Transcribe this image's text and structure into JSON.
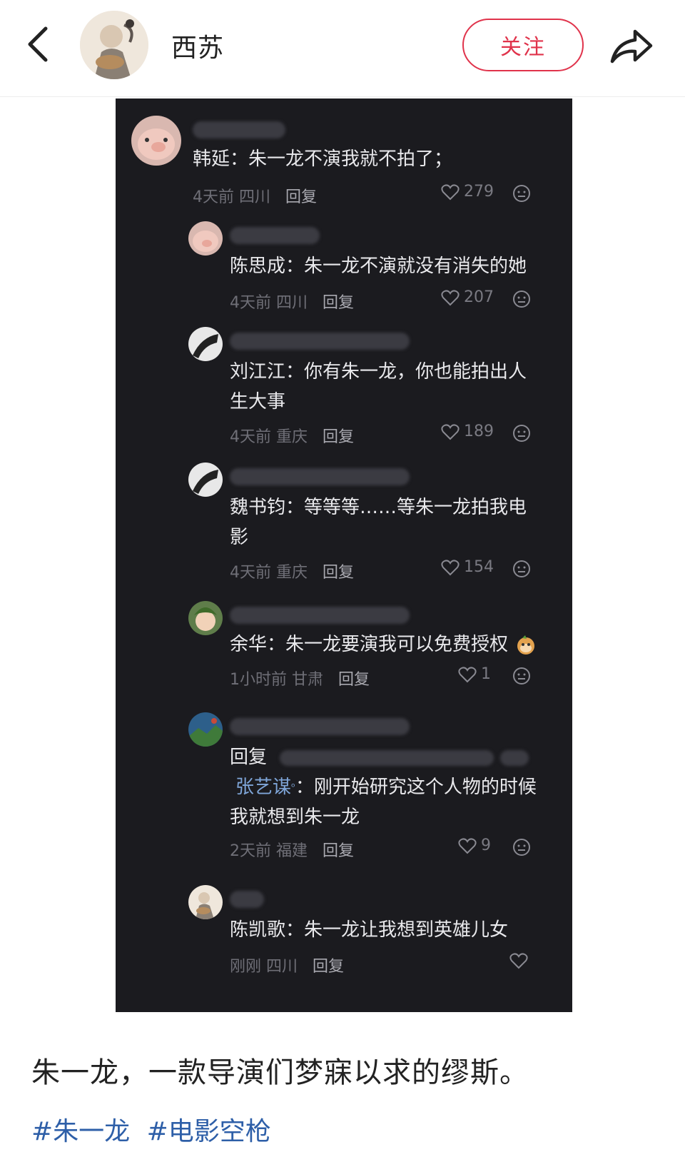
{
  "header": {
    "author_name": "西苏",
    "follow_label": "关注",
    "back_icon": "chevron-left-icon",
    "share_icon": "share-arrow-icon"
  },
  "comments": [
    {
      "text": "韩延：朱一龙不演我就不拍了；",
      "time": "4天前",
      "location": "四川",
      "reply": "回复",
      "likes": "279"
    },
    {
      "text": "陈思成：朱一龙不演就没有消失的她",
      "time": "4天前",
      "location": "四川",
      "reply": "回复",
      "likes": "207"
    },
    {
      "text": "刘江江：你有朱一龙，你也能拍出人生大事",
      "time": "4天前",
      "location": "重庆",
      "reply": "回复",
      "likes": "189"
    },
    {
      "text": "魏书钧：等等等……等朱一龙拍我电影",
      "time": "4天前",
      "location": "重庆",
      "reply": "回复",
      "likes": "154"
    },
    {
      "text": "余华：朱一龙要演我可以免费授权",
      "time": "1小时前",
      "location": "甘肃",
      "reply": "回复",
      "likes": "1"
    },
    {
      "reply_prefix": "回复",
      "mention": "张艺谋",
      "text": "：刚开始研究这个人物的时候我就想到朱一龙",
      "time": "2天前",
      "location": "福建",
      "reply": "回复",
      "likes": "9"
    },
    {
      "text": "陈凯歌：朱一龙让我想到英雄儿女",
      "time": "刚刚",
      "location": "四川",
      "reply": "回复",
      "likes": ""
    }
  ],
  "post": {
    "caption": "朱一龙，一款导演们梦寐以求的缪斯。",
    "tags": [
      "#朱一龙",
      "#电影空枪"
    ]
  },
  "colors": {
    "accent": "#e0334b",
    "tag_blue": "#2e5fa8",
    "dark_bg": "#1b1b1f",
    "mention_blue": "#7fa6d9"
  }
}
